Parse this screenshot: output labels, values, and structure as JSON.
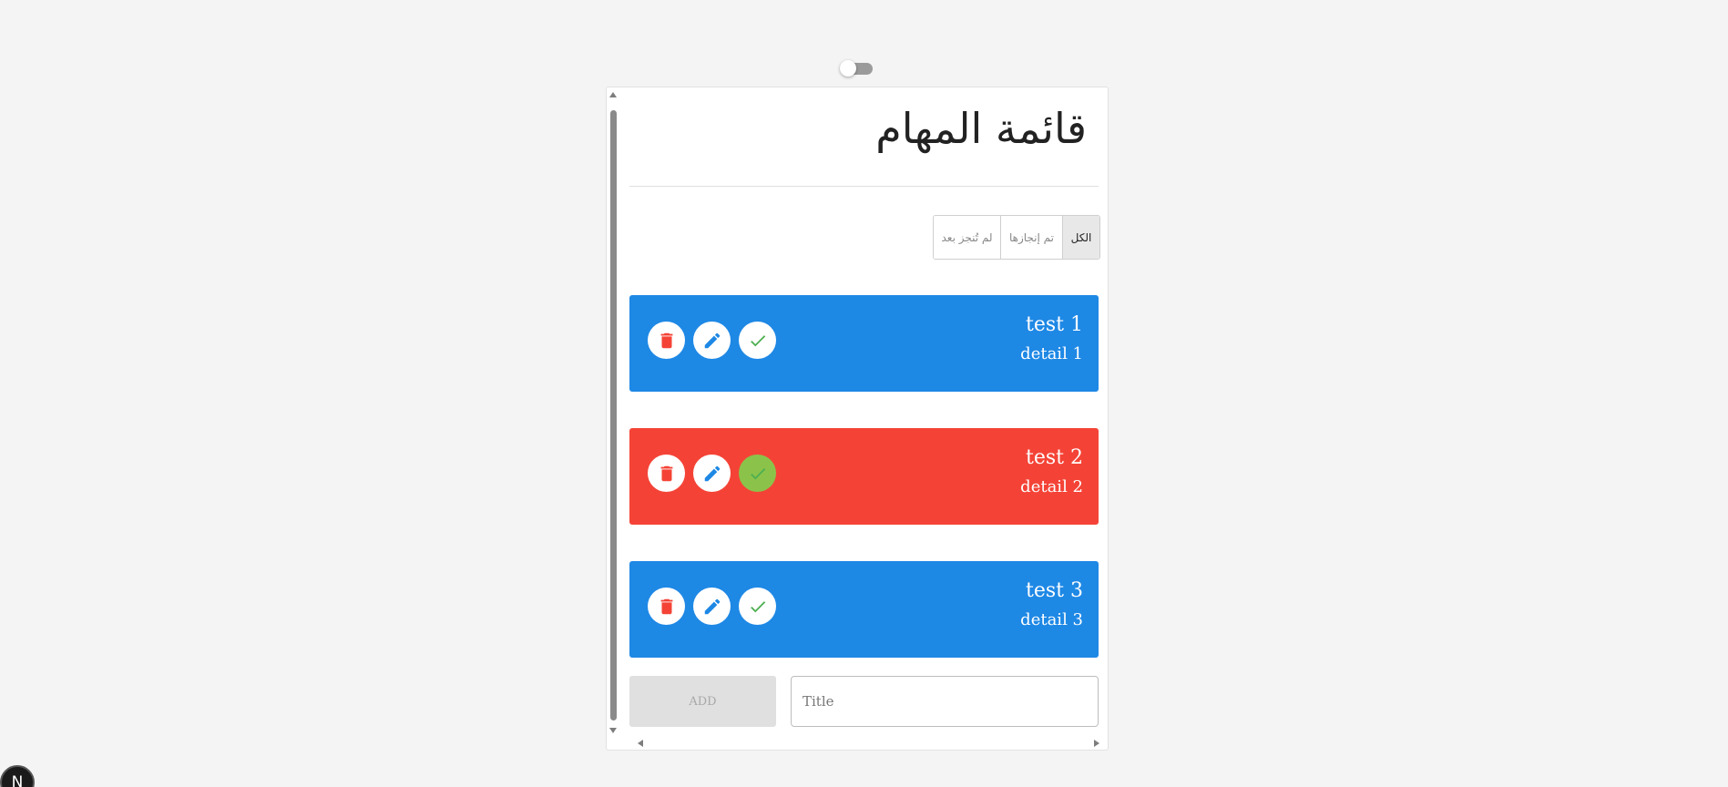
{
  "header": {
    "title": "قائمة المهام"
  },
  "filters": {
    "not_done": "لم تُنجز بعد",
    "done": "تم إنجازها",
    "all": "الكل"
  },
  "tasks": [
    {
      "title": "test 1",
      "detail": "detail 1",
      "color": "#1e88e5",
      "completed": false
    },
    {
      "title": "test 2",
      "detail": "detail 2",
      "color": "#f44336",
      "completed": true
    },
    {
      "title": "test 3",
      "detail": "detail 3",
      "color": "#1e88e5",
      "completed": false
    }
  ],
  "form": {
    "add_label": "ADD",
    "title_placeholder": "Title"
  },
  "badge": {
    "label": "N"
  },
  "colors": {
    "delete_icon": "#f44336",
    "edit_icon": "#1e88e5",
    "check_icon": "#4caf50",
    "check_done_bg": "#8bc34a"
  }
}
